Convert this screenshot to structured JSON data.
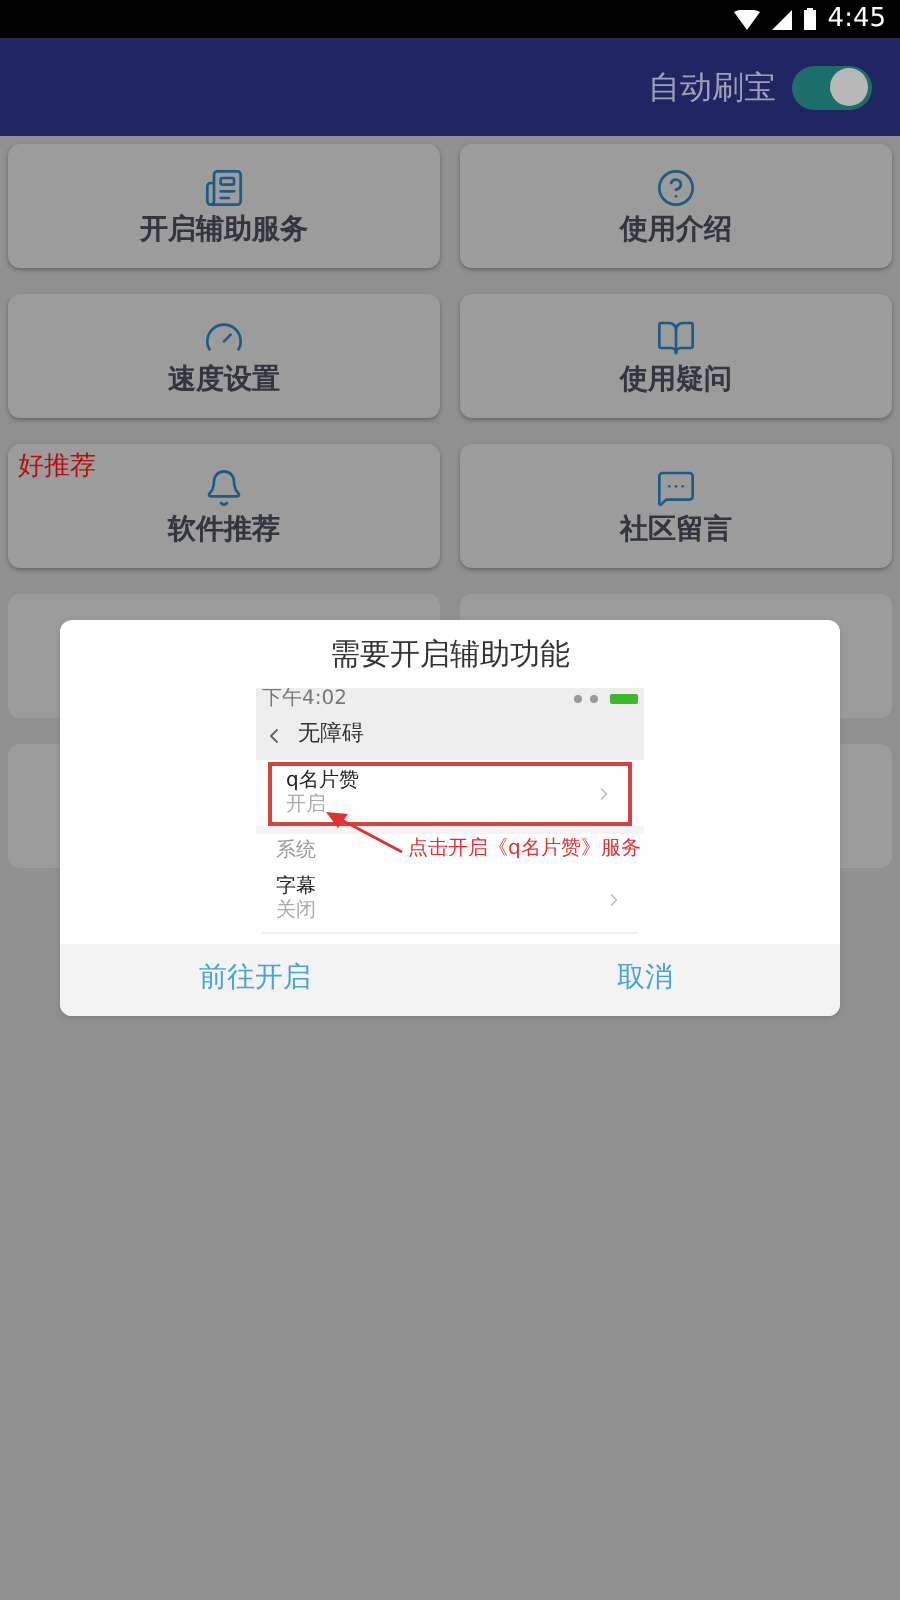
{
  "status_bar": {
    "time": "4:45"
  },
  "header": {
    "toggle": {
      "label": "自动刷宝",
      "on": true
    }
  },
  "tiles": [
    {
      "label": "开启辅助服务",
      "kind": "newspaper"
    },
    {
      "label": "使用介绍",
      "kind": "help"
    },
    {
      "label": "速度设置",
      "kind": "gauge"
    },
    {
      "label": "使用疑问",
      "kind": "book"
    },
    {
      "label": "软件推荐",
      "kind": "bell",
      "badge": "好推荐"
    },
    {
      "label": "社区留言",
      "kind": "chat"
    }
  ],
  "dialog": {
    "title": "需要开启辅助功能",
    "preview": {
      "time": "下午4:02",
      "title": "无障碍",
      "items": [
        {
          "kind": "item",
          "name": "q名片赞",
          "state": "开启",
          "highlighted": true
        },
        {
          "kind": "section",
          "name": "系统"
        },
        {
          "kind": "item",
          "name": "字幕",
          "state": "关闭",
          "highlighted": false
        }
      ],
      "annotation": "点击开启《q名片赞》服务"
    },
    "buttons": [
      "前往开启",
      "取消"
    ]
  }
}
